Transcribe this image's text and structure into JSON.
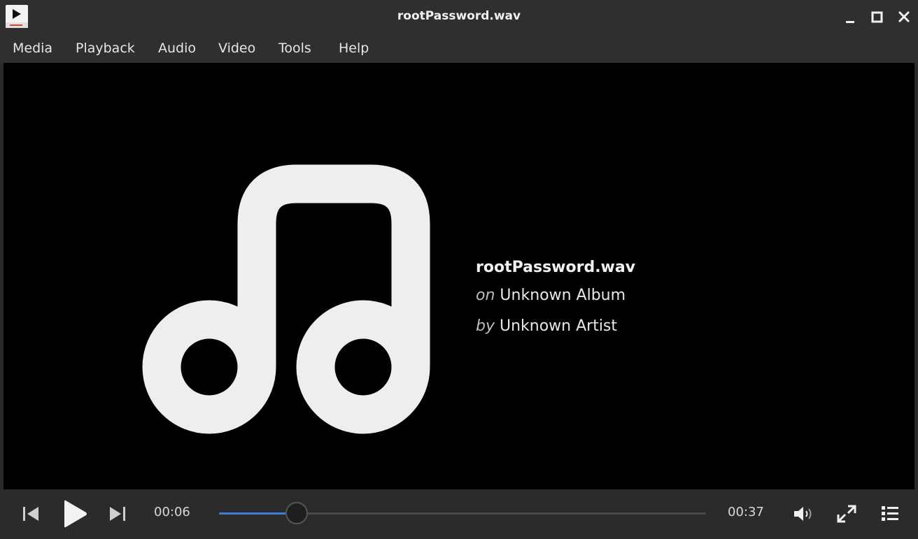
{
  "window": {
    "title": "rootPassword.wav",
    "app_icon": "vlc-play-icon",
    "controls": [
      "minimize-icon",
      "maximize-icon",
      "close-icon"
    ]
  },
  "menu": {
    "items": [
      "Media",
      "Playback",
      "Audio",
      "Video",
      "Tools",
      "Help"
    ]
  },
  "media_info": {
    "title": "rootPassword.wav",
    "album_prefix": "on",
    "album": "Unknown Album",
    "artist_prefix": "by",
    "artist": "Unknown Artist",
    "art_icon": "music-note-icon"
  },
  "player": {
    "current_time": "00:06",
    "total_time": "00:37",
    "progress_fraction": 0.16,
    "buttons": [
      "previous-icon",
      "play-icon",
      "next-icon",
      "volume-icon",
      "fullscreen-icon",
      "playlist-icon"
    ]
  },
  "colors": {
    "accent": "#3f7fd6",
    "background": "#2b2b2b",
    "video_bg": "#000000",
    "art": "#eeeeee"
  }
}
